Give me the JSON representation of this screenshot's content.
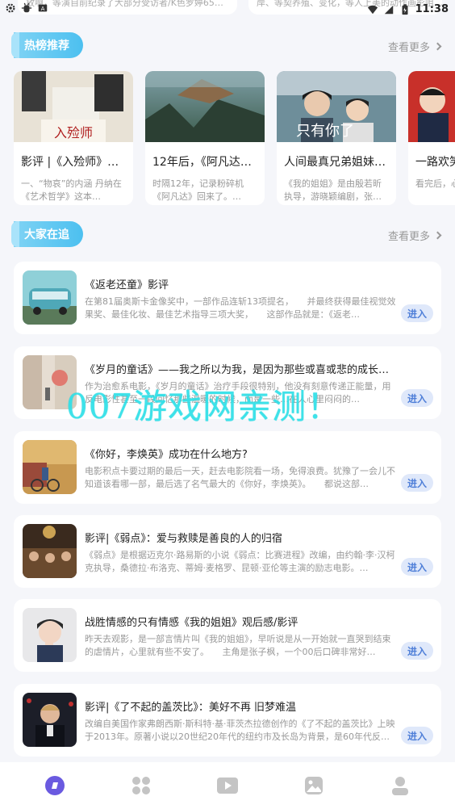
{
  "status_bar": {
    "time": "11:38",
    "left_icons": [
      "settings-icon",
      "bug-icon",
      "keyboard-icon"
    ],
    "right_icons": [
      "wifi-icon",
      "signal-icon",
      "battery-icon"
    ]
  },
  "top_partial": {
    "left_text": "放啊，等演自前纪录了大部分受访者/K色罗婷65…",
    "right_text": "岸、等契养殖、变化，等人上美的动作画影咀…"
  },
  "hot_section": {
    "badge": "热榜推荐",
    "more": "查看更多",
    "cards": [
      {
        "title": "影评 |《入殓师》的“…",
        "desc": "一、“物哀”的内涵 丹纳在《艺术哲学》这本…"
      },
      {
        "title": "12年后，《阿凡达…",
        "desc": "时隔12年，记录粉碎机《阿凡达》回来了。…"
      },
      {
        "title": "人间最真兄弟姐妹…",
        "desc": "《我的姐姐》是由殷若昕执导，游晓颖编剧，张…"
      },
      {
        "title": "一路欢笑",
        "desc": "看完后，心静。一直…"
      }
    ]
  },
  "follow_section": {
    "badge": "大家在追",
    "more": "查看更多",
    "enter_label": "进入",
    "items": [
      {
        "title": "《返老还童》影评",
        "desc": "在第81届奥斯卡金像奖中，一部作品连斩13项提名，　　并最终获得最佳视觉效果奖、最佳化妆、最佳艺术指导三项大奖，　　这部作品就是：《返老…"
      },
      {
        "title": "《岁月的童话》——我之所以为我，是因为那些或喜或悲的成长经…",
        "desc": "作为治愈系电影，《岁月的童话》治疗手段很特别，他没有刻意传递正能量，用反电影性甚至一段回忆那些温暖的时候，而是一些…在人心里闷闷的…"
      },
      {
        "title": "《你好，李焕英》成功在什么地方?",
        "desc": "电影积点卡要过期的最后一天，赶去电影院看一场，免得浪费。犹豫了一会儿不知道该看哪一部，最后选了名气最大的《你好，李焕英》。　　都说这部…"
      },
      {
        "title": "影评|《弱点》：爱与救赎是善良的人的归宿",
        "desc": "《弱点》是根据迈克尔·路易斯的小说《弱点：比赛进程》改编，由约翰·李·汉柯克执导，桑德拉·布洛克、蒂姆·麦格罗、昆顿·亚伦等主演的励志电影。…"
      },
      {
        "title": "战胜情感的只有情感《我的姐姐》观后感/影评",
        "desc": "昨天去观影，是一部言情片叫《我的姐姐》，早听说是从一开始就一直哭到结束的虐情片，心里就有些不安了。　　主角是张子枫，一个00后口碑非常好…"
      },
      {
        "title": "影评|《了不起的盖茨比》：美好不再 旧梦难温",
        "desc": "改编自美国作家弗朗西斯·斯科特·基·菲茨杰拉德创作的《了不起的盖茨比》上映于2013年。原著小说以20世纪20年代的纽约市及长岛为背景，是60年代反…"
      }
    ]
  },
  "watermark": "007游戏网亲测！",
  "bottom_nav": [
    {
      "name": "home",
      "icon": "home-icon"
    },
    {
      "name": "category",
      "icon": "grid-icon"
    },
    {
      "name": "video",
      "icon": "video-icon"
    },
    {
      "name": "gallery",
      "icon": "image-icon"
    },
    {
      "name": "profile",
      "icon": "user-icon"
    }
  ],
  "colors": {
    "accent": "#4cc0f0",
    "enter_bg": "#dfe8fa",
    "enter_text": "#4f7fd8",
    "nav_active": "#6a5ae0",
    "nav_inactive": "#c4c4c4",
    "watermark": "#2ee0e8"
  }
}
